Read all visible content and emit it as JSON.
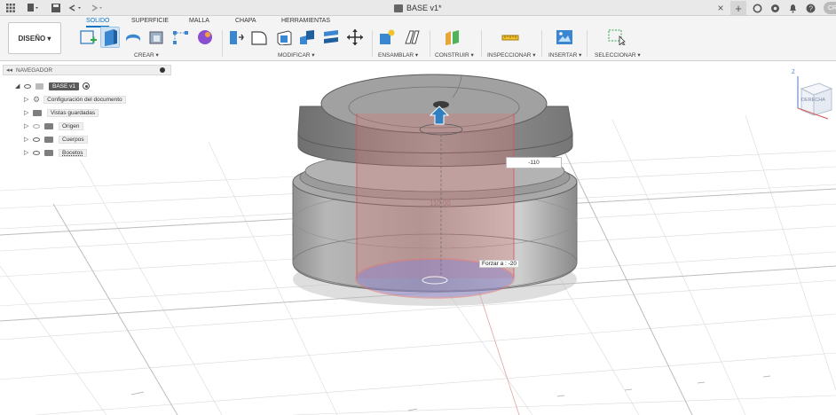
{
  "titlebar": {
    "document_title": "BASE v1*",
    "close_label": "×",
    "add_label": "+",
    "user_initials": "CR"
  },
  "toolbar": {
    "workspace_label": "DISEÑO ▾",
    "tabs": [
      "SOLIDO",
      "SUPERFICIE",
      "MALLA",
      "CHAPA",
      "HERRAMIENTAS"
    ],
    "active_tab": "SOLIDO",
    "groups": [
      "CREAR ▾",
      "MODIFICAR ▾",
      "ENSAMBLAR ▾",
      "CONSTRUIR ▾",
      "INSPECCIONAR ▾",
      "INSERTAR ▾",
      "SELECCIONAR ▾"
    ]
  },
  "navigator": {
    "title": "NAVEGADOR",
    "root_label": "BASE v1",
    "items": [
      "Configuración del documento",
      "Vistas guardadas",
      "Origen",
      "Cuerpos",
      "Bocetos"
    ]
  },
  "viewport": {
    "dimension_value": "-110",
    "force_label": "Forzar a : -20",
    "ghost_dimension": "110.00",
    "viewcube_label": "DERECHA",
    "axis_label": "Z"
  },
  "colors": {
    "accent": "#0a74c4",
    "body_gray": "#9a9a9a",
    "extrude_red": "#e36b6b"
  }
}
